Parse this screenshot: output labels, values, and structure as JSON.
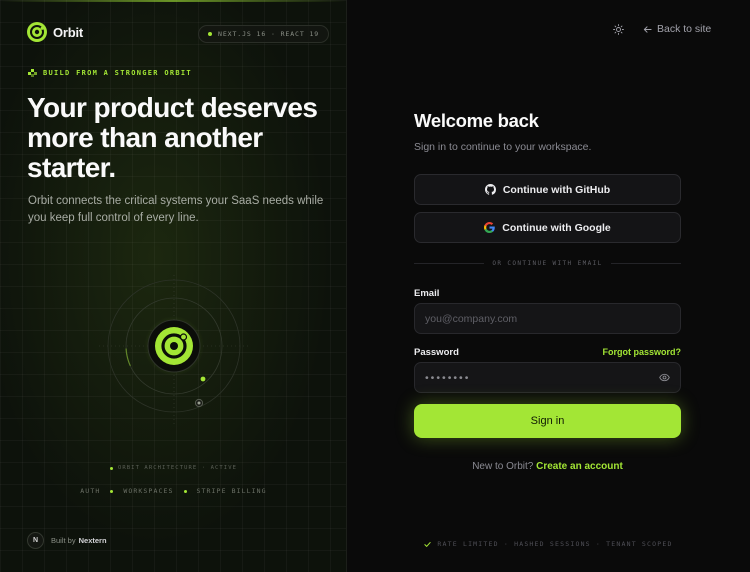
{
  "brand": {
    "name": "Orbit",
    "logo_icon": "orbit-logo-icon"
  },
  "stack_pill": {
    "text": "NEXT.JS 16 · REACT 19"
  },
  "hero": {
    "eyebrow": "BUILD FROM A STRONGER ORBIT",
    "headline": "Your product deserves more than another starter.",
    "subhead": "Orbit connects the critical systems your SaaS needs while you keep full control of every line."
  },
  "architecture": {
    "status": "ORBIT ARCHITECTURE · ACTIVE",
    "modules": [
      "AUTH",
      "WORKSPACES",
      "STRIPE BILLING"
    ]
  },
  "built_by": {
    "badge": "N",
    "prefix": "Built by",
    "name": "Nextern"
  },
  "topbar": {
    "theme_icon": "sun-icon",
    "back_label": "Back to site"
  },
  "form": {
    "title": "Welcome back",
    "subtitle": "Sign in to continue to your workspace.",
    "github_label": "Continue with GitHub",
    "google_label": "Continue with Google",
    "divider": "OR CONTINUE WITH EMAIL",
    "email_label": "Email",
    "email_placeholder": "you@company.com",
    "password_label": "Password",
    "forgot_label": "Forgot password?",
    "password_value": "••••••••",
    "submit_label": "Sign in",
    "signup_prompt": "New to Orbit?",
    "signup_link": "Create an account"
  },
  "footer_note": "RATE LIMITED · HASHED SESSIONS · TENANT SCOPED",
  "colors": {
    "accent": "#a3e635",
    "background": "#0a0a0a",
    "panel": "#0d120b",
    "input": "#151517"
  }
}
